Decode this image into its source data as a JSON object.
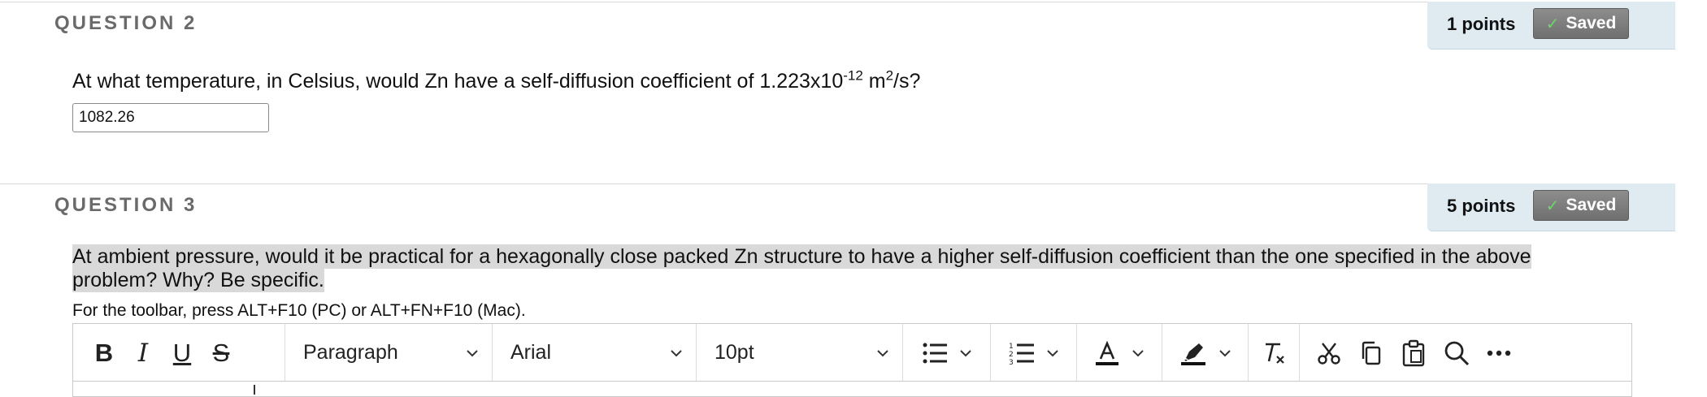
{
  "question2": {
    "title": "QUESTION 2",
    "points": "1 points",
    "saved_label": "Saved",
    "text_before": "At what temperature, in Celsius, would Zn have a self-diffusion coefficient of 1.223x10",
    "exp1": "-12",
    "text_mid": " m",
    "exp2": "2",
    "text_after": "/s?",
    "answer_value": "1082.26"
  },
  "question3": {
    "title": "QUESTION 3",
    "points": "5 points",
    "saved_label": "Saved",
    "text": "At ambient pressure, would it be practical for a hexagonally close packed Zn structure to have a higher self-diffusion coefficient than the one specified in the above problem?  Why?  Be specific. ",
    "toolbar_hint": "For the toolbar, press ALT+F10 (PC) or ALT+FN+F10 (Mac)."
  },
  "toolbar": {
    "bold": "B",
    "italic": "I",
    "underline": "U",
    "strikethrough": "S",
    "block_format": "Paragraph",
    "font_family": "Arial",
    "font_size": "10pt"
  },
  "colors": {
    "points_bg": "#dfeaf1",
    "saved_bg": "#7a7a7a",
    "check": "#6cd56c",
    "highlight": "#d9d9d9"
  }
}
